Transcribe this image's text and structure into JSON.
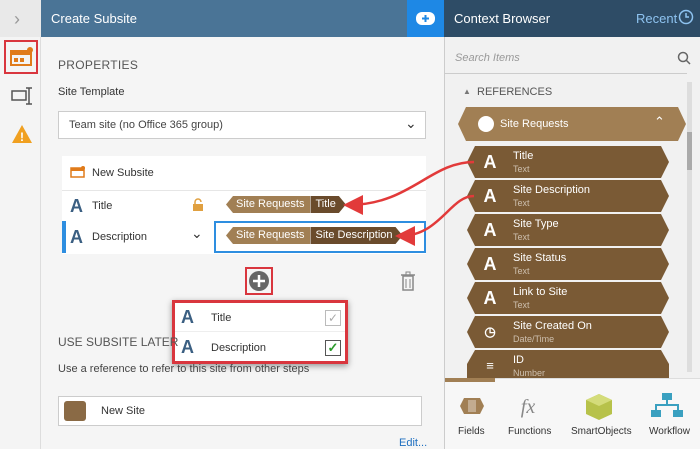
{
  "main": {
    "title": "Create Subsite",
    "properties_heading": "PROPERTIES",
    "site_template_label": "Site Template",
    "site_template_value": "Team site (no Office 365 group)",
    "new_subsite_label": "New Subsite",
    "rows": [
      {
        "label": "Title",
        "ref_a": "Site Requests",
        "ref_b": "Title"
      },
      {
        "label": "Description",
        "ref_a": "Site Requests",
        "ref_b": "Site Description"
      }
    ],
    "popup": [
      {
        "label": "Title",
        "checked": false
      },
      {
        "label": "Description",
        "checked": true
      }
    ],
    "use_later_heading": "USE SUBSITE LATER",
    "use_later_text": "Use a reference to refer to this site from other steps",
    "new_site_label": "New Site",
    "edit_link": "Edit..."
  },
  "context": {
    "title": "Context Browser",
    "recent": "Recent",
    "search_placeholder": "Search Items",
    "references_heading": "REFERENCES",
    "group": "Site Requests",
    "items": [
      {
        "name": "Title",
        "type": "Text",
        "icon": "A"
      },
      {
        "name": "Site Description",
        "type": "Text",
        "icon": "A"
      },
      {
        "name": "Site Type",
        "type": "Text",
        "icon": "A"
      },
      {
        "name": "Site Status",
        "type": "Text",
        "icon": "A"
      },
      {
        "name": "Link to Site",
        "type": "Text",
        "icon": "A"
      },
      {
        "name": "Site Created On",
        "type": "Date/Time",
        "icon": "clock"
      },
      {
        "name": "ID",
        "type": "Number",
        "icon": "num"
      }
    ],
    "tabs": [
      "Fields",
      "Functions",
      "SmartObjects",
      "Workflow"
    ]
  },
  "colors": {
    "header": "#4a7496",
    "ctx_header": "#2e4c66",
    "ref_brown": "#7a5a35",
    "highlight_red": "#d9363e"
  }
}
